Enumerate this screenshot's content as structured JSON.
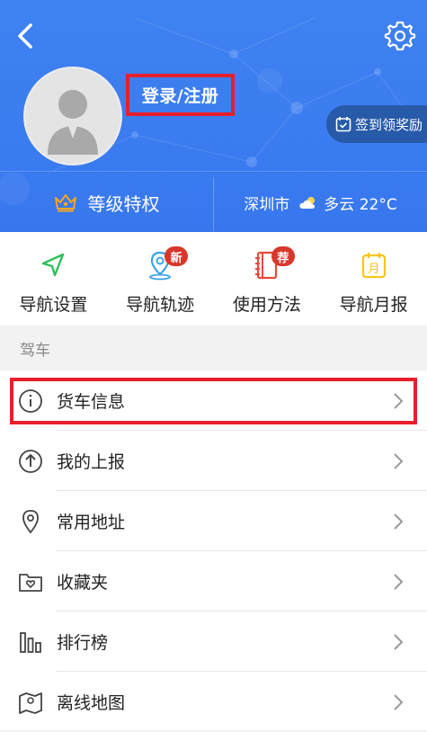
{
  "header": {
    "back_icon": "back-arrow-icon",
    "settings_icon": "gear-icon",
    "login_text": "登录/注册",
    "checkin_text": "签到领奖励",
    "vip_label": "等级特权",
    "city": "深圳市",
    "weather_text": "多云 22°C"
  },
  "quick_actions": [
    {
      "label": "导航设置",
      "icon": "navigation-arrow-icon",
      "badge": ""
    },
    {
      "label": "导航轨迹",
      "icon": "location-pin-icon",
      "badge": "新"
    },
    {
      "label": "使用方法",
      "icon": "notebook-icon",
      "badge": "荐"
    },
    {
      "label": "导航月报",
      "icon": "calendar-icon",
      "badge": ""
    }
  ],
  "section": {
    "title": "驾车"
  },
  "menu": [
    {
      "label": "货车信息",
      "icon": "info-circle-icon"
    },
    {
      "label": "我的上报",
      "icon": "upload-arrow-icon"
    },
    {
      "label": "常用地址",
      "icon": "map-pin-icon"
    },
    {
      "label": "收藏夹",
      "icon": "favorites-folder-icon"
    },
    {
      "label": "排行榜",
      "icon": "ranking-bars-icon"
    },
    {
      "label": "离线地图",
      "icon": "offline-map-icon"
    }
  ],
  "colors": {
    "header_blue": "#3a7bf0",
    "highlight_red": "#e81f2b",
    "badge_red": "#d9372b"
  }
}
